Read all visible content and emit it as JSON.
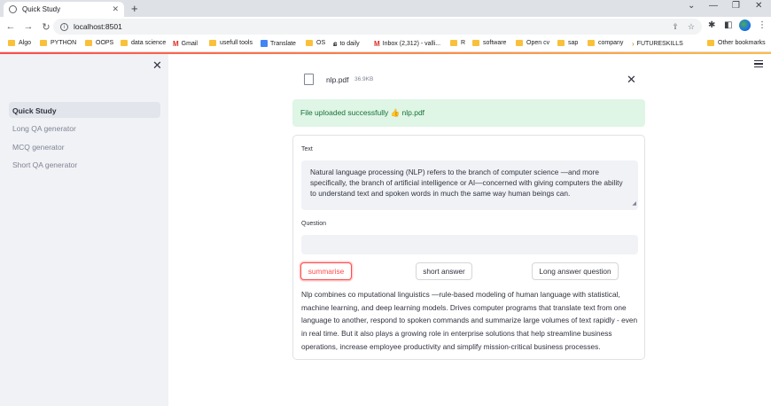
{
  "browser": {
    "tab_title": "Quick Study",
    "tab_close": "✕",
    "new_tab": "+",
    "window_controls": [
      "⌄",
      "—",
      "❐",
      "✕"
    ],
    "address": "localhost:8501",
    "nav": {
      "back": "←",
      "forward": "→",
      "reload": "↻"
    },
    "bookmarks": [
      {
        "label": "Algo",
        "kind": "folder"
      },
      {
        "label": "PYTHON",
        "kind": "folder"
      },
      {
        "label": "OOPS",
        "kind": "folder"
      },
      {
        "label": "data science",
        "kind": "folder"
      },
      {
        "label": "Gmail",
        "kind": "gmail"
      },
      {
        "label": "usefull tools",
        "kind": "folder"
      },
      {
        "label": "Translate",
        "kind": "translate"
      },
      {
        "label": "OS",
        "kind": "folder"
      },
      {
        "label": "to daily",
        "kind": "link"
      },
      {
        "label": "Inbox (2,312) - valli...",
        "kind": "gmail"
      },
      {
        "label": "R",
        "kind": "folder"
      },
      {
        "label": "software",
        "kind": "folder"
      },
      {
        "label": "Open cv",
        "kind": "folder"
      },
      {
        "label": "sap",
        "kind": "folder"
      },
      {
        "label": "company",
        "kind": "folder"
      },
      {
        "label": "FUTURESKILLS",
        "kind": "arrow"
      }
    ],
    "other_bookmarks": "Other bookmarks"
  },
  "sidebar": {
    "close": "✕",
    "items": [
      {
        "label": "Quick Study",
        "active": true
      },
      {
        "label": "Long QA generator",
        "active": false
      },
      {
        "label": "MCQ generator",
        "active": false
      },
      {
        "label": "Short QA generator",
        "active": false
      }
    ]
  },
  "uploader": {
    "file_name": "nlp.pdf",
    "file_size": "36.9KB",
    "remove": "✕"
  },
  "success_message": "File uploaded successfully 👍 nlp.pdf",
  "form": {
    "text_label": "Text",
    "text_value": "Natural language processing (NLP) refers to the branch of computer science —and more specifically, the branch of  artificial  intelligence  or AI—concerned with giving computers the ability to understand text and spoken words in much the same way human beings can.",
    "question_label": "Question",
    "question_value": "",
    "buttons": {
      "summarise": "summarise",
      "short_answer": "short answer",
      "long_answer": "Long answer question"
    },
    "summary": "Nlp combines co mputational linguistics —rule-based modeling of human language with statistical, machine learning, and deep learning models. Drives computer programs that translate text from one language to another, respond to spoken commands and summarize large volumes of text rapidly - even in real time. But it also plays a growing role in enterprise solutions that help streamline business operations, increase employee productivity and simplify mission-critical business processes."
  },
  "colors": {
    "accent": "#ff4b4b",
    "success_bg": "#dff5e6",
    "success_text": "#177233",
    "sidebar_bg": "#f0f2f6"
  }
}
